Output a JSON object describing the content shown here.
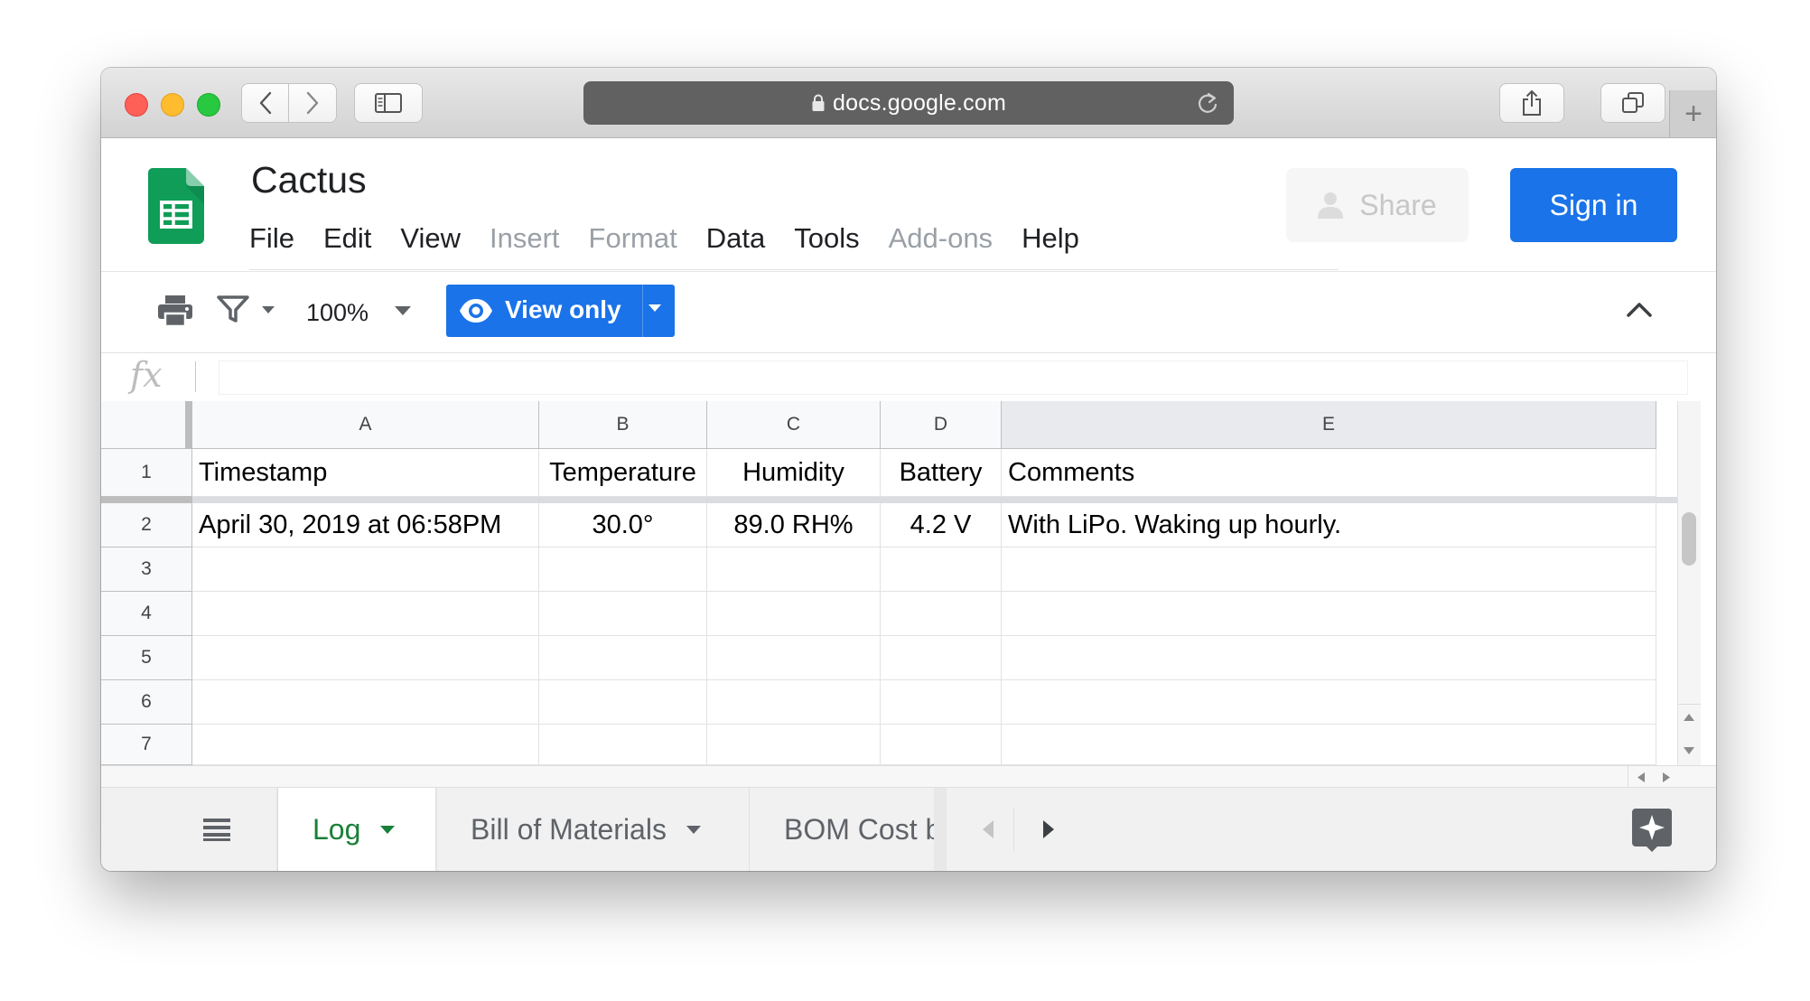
{
  "browser": {
    "address": "docs.google.com"
  },
  "doc": {
    "title": "Cactus"
  },
  "menu": [
    "File",
    "Edit",
    "View",
    "Insert",
    "Format",
    "Data",
    "Tools",
    "Add-ons",
    "Help"
  ],
  "header": {
    "share_label": "Share",
    "signin_label": "Sign in"
  },
  "toolbar": {
    "zoom": "100%",
    "view_only_label": "View only"
  },
  "formula_bar": {
    "fx_label": "fx",
    "value": ""
  },
  "columns": [
    "A",
    "B",
    "C",
    "D",
    "E"
  ],
  "rows": [
    "1",
    "2",
    "3",
    "4",
    "5",
    "6",
    "7"
  ],
  "cells": {
    "row1": [
      "Timestamp",
      "Temperature",
      "Humidity",
      "Battery",
      "Comments"
    ],
    "row2": [
      "April 30, 2019 at 06:58PM",
      "30.0°",
      "89.0 RH%",
      "4.2 V",
      "With LiPo. Waking up hourly."
    ]
  },
  "sheets": {
    "tabs": [
      "Log",
      "Bill of Materials",
      "BOM Cost b"
    ]
  },
  "colors": {
    "accent_blue": "#1a73e8",
    "sheets_green": "#188038",
    "sheets_logo_green": "#0f9d58"
  }
}
